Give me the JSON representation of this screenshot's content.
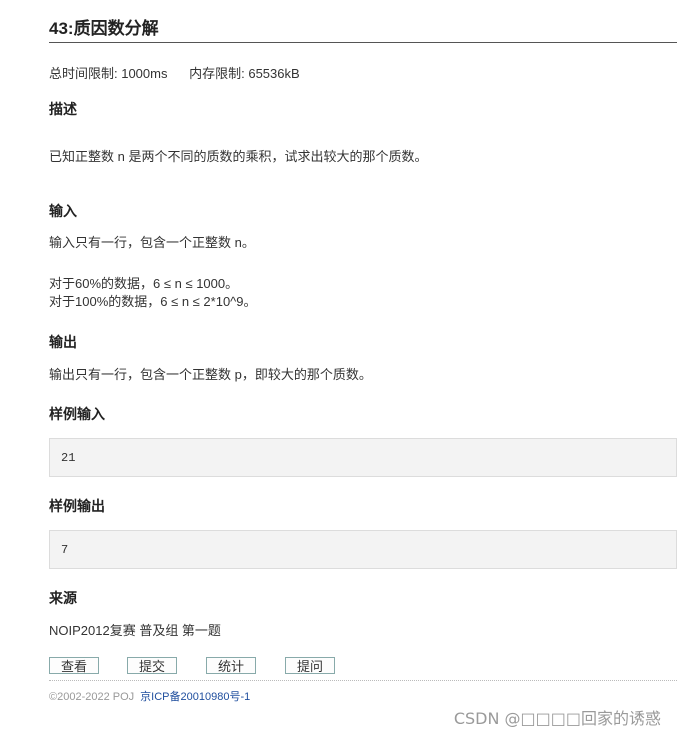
{
  "problem": {
    "title": "43:质因数分解",
    "time_limit": "总时间限制: 1000ms",
    "memory_limit": "内存限制: 65536kB"
  },
  "description": {
    "heading": "描述",
    "text": "已知正整数 n 是两个不同的质数的乘积，试求出较大的那个质数。"
  },
  "input": {
    "heading": "输入",
    "line1": "输入只有一行，包含一个正整数 n。",
    "line2": "对于60%的数据，6 ≤ n ≤ 1000。",
    "line3": "对于100%的数据，6 ≤ n ≤ 2*10^9。"
  },
  "output": {
    "heading": "输出",
    "text": "输出只有一行，包含一个正整数 p，即较大的那个质数。"
  },
  "sample_input": {
    "heading": "样例输入",
    "value": "21"
  },
  "sample_output": {
    "heading": "样例输出",
    "value": "7"
  },
  "source": {
    "heading": "来源",
    "text": "NOIP2012复赛 普及组 第一题"
  },
  "buttons": {
    "view": "查看",
    "submit": "提交",
    "stats": "统计",
    "ask": "提问"
  },
  "footer": {
    "copyright": "©2002-2022 POJ",
    "icp": "京ICP备20010980号-1"
  },
  "watermark": "CSDN @□□□□回家的诱惑"
}
